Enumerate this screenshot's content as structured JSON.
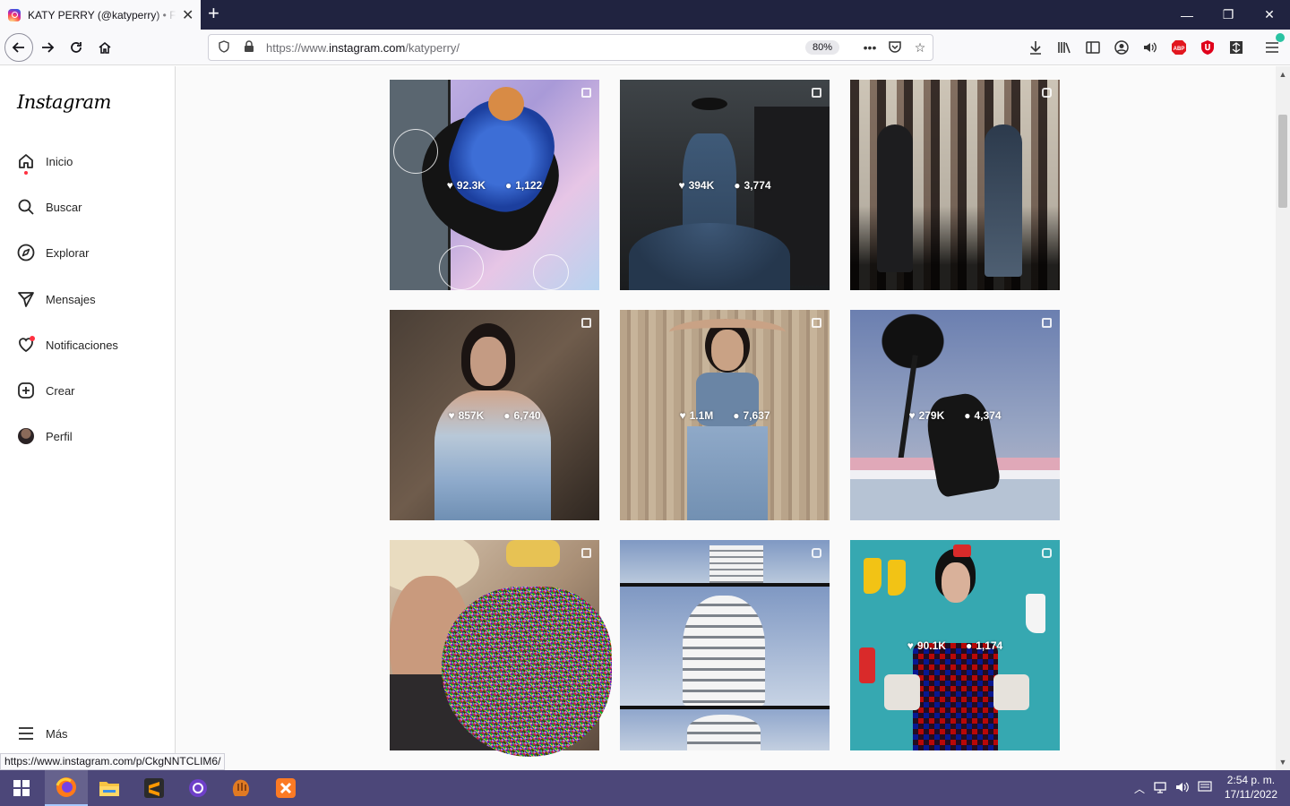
{
  "browser": {
    "tab_title": "KATY PERRY (@katyperry) • Fotos y videos de Instagram",
    "new_tab": "+",
    "url_prefix": "https://www.",
    "url_domain": "instagram.com",
    "url_path": "/katyperry/",
    "zoom": "80%",
    "status_url": "https://www.instagram.com/p/CkgNNTCLIM6/"
  },
  "sidebar": {
    "logo": "Instagram",
    "items": [
      {
        "label": "Inicio",
        "icon": "home-icon"
      },
      {
        "label": "Buscar",
        "icon": "search-icon"
      },
      {
        "label": "Explorar",
        "icon": "compass-icon"
      },
      {
        "label": "Mensajes",
        "icon": "messenger-icon"
      },
      {
        "label": "Notificaciones",
        "icon": "heart-icon"
      },
      {
        "label": "Crear",
        "icon": "plus-square-icon"
      },
      {
        "label": "Perfil",
        "icon": "avatar"
      }
    ],
    "more": "Más"
  },
  "posts": [
    {
      "likes": "92.3K",
      "comments": "1,122",
      "type": "carousel"
    },
    {
      "likes": "394K",
      "comments": "3,774",
      "type": "carousel"
    },
    {
      "likes": "",
      "comments": "",
      "type": "reel"
    },
    {
      "likes": "857K",
      "comments": "6,740",
      "type": "carousel"
    },
    {
      "likes": "1.1M",
      "comments": "7,637",
      "type": "carousel"
    },
    {
      "likes": "279K",
      "comments": "4,374",
      "type": "carousel"
    },
    {
      "likes": "",
      "comments": "",
      "type": "carousel"
    },
    {
      "likes": "",
      "comments": "",
      "type": "reel"
    },
    {
      "likes": "90.1K",
      "comments": "1,174",
      "type": "reel"
    }
  ],
  "taskbar": {
    "time": "2:54 p. m.",
    "date": "17/11/2022"
  }
}
